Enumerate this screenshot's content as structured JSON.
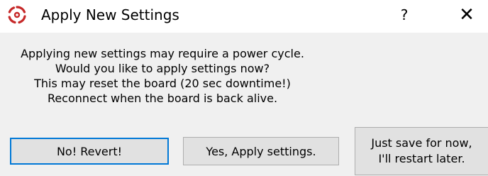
{
  "window": {
    "title": "Apply New Settings",
    "help_label": "?",
    "close_label": "✕",
    "icon": "app-logo-icon",
    "accent_color": "#c62828"
  },
  "message": {
    "lines": [
      "Applying new settings may require a power cycle.",
      "Would you like to apply settings now?",
      "This may reset the board (20 sec downtime!)",
      "Reconnect when the board is back alive."
    ]
  },
  "buttons": {
    "revert_label": "No! Revert!",
    "apply_label": "Yes, Apply settings.",
    "save_label_line1": "Just save for now,",
    "save_label_line2": "I'll restart later."
  }
}
